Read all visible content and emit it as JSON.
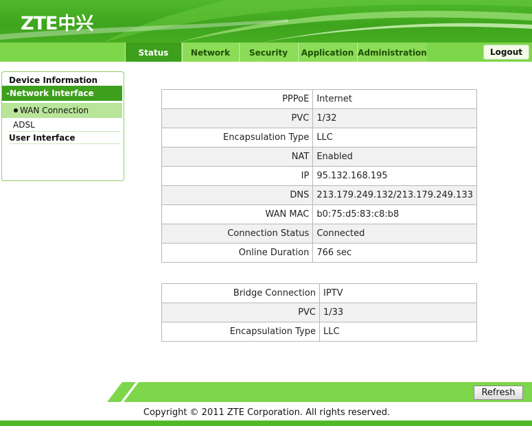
{
  "brand": {
    "logo_text": "ZTE",
    "logo_cn": "中兴"
  },
  "nav": {
    "tabs": [
      {
        "label": "Status",
        "active": true
      },
      {
        "label": "Network",
        "active": false
      },
      {
        "label": "Security",
        "active": false
      },
      {
        "label": "Application",
        "active": false
      },
      {
        "label": "Administration",
        "active": false
      }
    ],
    "logout_label": "Logout"
  },
  "sidebar": {
    "device_information": "Device Information",
    "network_interface": "-Network Interface",
    "wan_connection": "WAN Connection",
    "adsl": "ADSL",
    "user_interface": "User Interface"
  },
  "pppoe_table": [
    {
      "key": "PPPoE",
      "value": "Internet"
    },
    {
      "key": "PVC",
      "value": "1/32"
    },
    {
      "key": "Encapsulation Type",
      "value": "LLC"
    },
    {
      "key": "NAT",
      "value": "Enabled"
    },
    {
      "key": "IP",
      "value": "95.132.168.195"
    },
    {
      "key": "DNS",
      "value": "213.179.249.132/213.179.249.133"
    },
    {
      "key": "WAN MAC",
      "value": "b0:75:d5:83:c8:b8"
    },
    {
      "key": "Connection Status",
      "value": "Connected"
    },
    {
      "key": "Online Duration",
      "value": "766 sec"
    }
  ],
  "bridge_table": [
    {
      "key": "Bridge Connection",
      "value": "IPTV"
    },
    {
      "key": "PVC",
      "value": "1/33"
    },
    {
      "key": "Encapsulation Type",
      "value": "LLC"
    }
  ],
  "footer": {
    "refresh_label": "Refresh",
    "copyright": "Copyright © 2011 ZTE Corporation. All rights reserved."
  },
  "colors": {
    "brand_green": "#4fb92a",
    "active_tab": "#3d9f1b",
    "nav_bg": "#8cdc57"
  }
}
